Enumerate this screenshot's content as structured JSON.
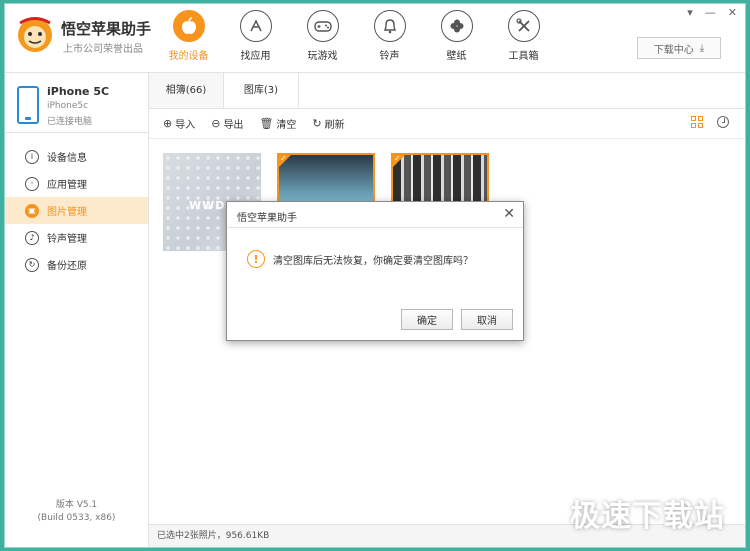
{
  "app": {
    "title": "悟空苹果助手",
    "subtitle": "上市公司荣誉出品"
  },
  "nav": [
    {
      "label": "我的设备",
      "icon": "apple-icon",
      "active": true
    },
    {
      "label": "找应用",
      "icon": "app-store-icon",
      "active": false
    },
    {
      "label": "玩游戏",
      "icon": "gamepad-icon",
      "active": false
    },
    {
      "label": "铃声",
      "icon": "bell-icon",
      "active": false
    },
    {
      "label": "壁纸",
      "icon": "clover-icon",
      "active": false
    },
    {
      "label": "工具箱",
      "icon": "tools-icon",
      "active": false
    }
  ],
  "header": {
    "download_label": "下载中心"
  },
  "device": {
    "name": "iPhone 5C",
    "model": "iPhone5c",
    "status": "已连接电脑"
  },
  "sidebar": {
    "items": [
      {
        "label": "设备信息",
        "glyph": "i"
      },
      {
        "label": "应用管理",
        "glyph": "◦"
      },
      {
        "label": "图片管理",
        "glyph": "▣"
      },
      {
        "label": "铃声管理",
        "glyph": "♪"
      },
      {
        "label": "备份还原",
        "glyph": "↻"
      }
    ],
    "version": "版本 V5.1",
    "build": "(Build 0533, x86)"
  },
  "tabs": [
    {
      "label": "相簿(66)"
    },
    {
      "label": "图库(3)"
    }
  ],
  "toolbar": {
    "import_label": "导入",
    "export_label": "导出",
    "clear_label": "清空",
    "refresh_label": "刷新"
  },
  "status": {
    "text": "已选中2张照片，956.61KB"
  },
  "dialog": {
    "title": "悟空苹果助手",
    "message": "清空图库后无法恢复，你确定要清空图库吗？",
    "ok_label": "确定",
    "cancel_label": "取消"
  },
  "thumbnails": {
    "thumb1_text": "WWDC"
  },
  "watermark": "极速下载站",
  "colors": {
    "accent": "#f7941d",
    "frame": "#3fb1a0"
  }
}
